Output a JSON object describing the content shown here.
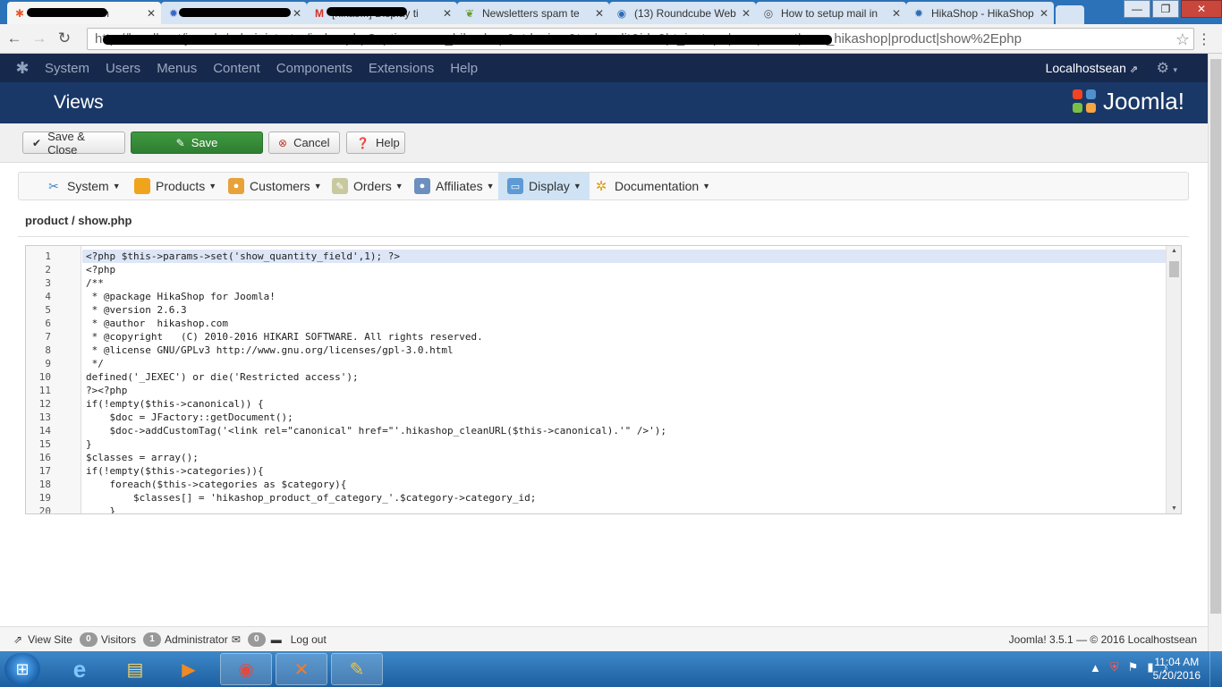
{
  "browser": {
    "tabs": [
      {
        "label": "lhostsean - Adm",
        "favicon": "joomla-icon",
        "favicon_color": "#e8562a"
      },
      {
        "label": "",
        "favicon": "hikashop-icon",
        "favicon_color": "#3b66c4"
      },
      {
        "label": "[hikas...] Display ti",
        "favicon": "gmail-icon",
        "favicon_color": "#d93025"
      },
      {
        "label": "Newsletters spam te",
        "favicon": "leaf-icon",
        "favicon_color": "#6a9a2f"
      },
      {
        "label": "(13) Roundcube Web",
        "favicon": "roundcube-icon",
        "favicon_color": "#2f6db3"
      },
      {
        "label": "How to setup mail in",
        "favicon": "globe-icon",
        "favicon_color": "#555555"
      },
      {
        "label": "HikaShop - HikaShop",
        "favicon": "hikashop-icon",
        "favicon_color": "#2e6fb0"
      }
    ],
    "url": "http://localhost/joomla/administrator/index.php?option=com_hikashop&ctrl=view&task=edit&id=0|rt_isotope|component|com_hikashop|product|show%2Ephp",
    "window_buttons": {
      "minimize": "—",
      "maximize": "❐",
      "close": "✕"
    }
  },
  "joomla_nav": {
    "items": [
      "System",
      "Users",
      "Menus",
      "Content",
      "Components",
      "Extensions",
      "Help"
    ],
    "site_name": "Localhostsean"
  },
  "header": {
    "title": "Views",
    "brand": "Joomla!"
  },
  "toolbar": {
    "save_close": "Save & Close",
    "save": "Save",
    "cancel": "Cancel",
    "help": "Help"
  },
  "hikashop_menu": {
    "items": [
      {
        "label": "System",
        "icon": "tools-icon"
      },
      {
        "label": "Products",
        "icon": "box-icon"
      },
      {
        "label": "Customers",
        "icon": "users-icon"
      },
      {
        "label": "Orders",
        "icon": "orders-icon"
      },
      {
        "label": "Affiliates",
        "icon": "affiliates-icon"
      },
      {
        "label": "Display",
        "icon": "display-icon",
        "active": true
      },
      {
        "label": "Documentation",
        "icon": "documentation-icon"
      }
    ]
  },
  "file_heading": "product / show.php",
  "editor": {
    "current_line": 1,
    "lines": [
      {
        "n": "1",
        "text": "<?php $this->params->set('show_quantity_field',1); ?>"
      },
      {
        "n": "2",
        "text": "<?php"
      },
      {
        "n": "3",
        "text": "/**"
      },
      {
        "n": "4",
        "text": " * @package HikaShop for Joomla!"
      },
      {
        "n": "5",
        "text": " * @version 2.6.3"
      },
      {
        "n": "6",
        "text": " * @author  hikashop.com"
      },
      {
        "n": "7",
        "text": " * @copyright   (C) 2010-2016 HIKARI SOFTWARE. All rights reserved."
      },
      {
        "n": "8",
        "text": " * @license GNU/GPLv3 http://www.gnu.org/licenses/gpl-3.0.html"
      },
      {
        "n": "9",
        "text": " */"
      },
      {
        "n": "10",
        "text": "defined('_JEXEC') or die('Restricted access');"
      },
      {
        "n": "11",
        "text": "?><?php"
      },
      {
        "n": "12",
        "text": "if(!empty($this->canonical)) {"
      },
      {
        "n": "13",
        "text": "    $doc = JFactory::getDocument();"
      },
      {
        "n": "14",
        "text": "    $doc->addCustomTag('<link rel=\"canonical\" href=\"'.hikashop_cleanURL($this->canonical).'\" />');"
      },
      {
        "n": "15",
        "text": "}"
      },
      {
        "n": "16",
        "text": "$classes = array();"
      },
      {
        "n": "17",
        "text": "if(!empty($this->categories)){"
      },
      {
        "n": "18",
        "text": "    foreach($this->categories as $category){"
      },
      {
        "n": "19",
        "text": "        $classes[] = 'hikashop_product_of_category_'.$category->category_id;"
      },
      {
        "n": "20",
        "text": "    }"
      }
    ]
  },
  "status": {
    "view_site": "View Site",
    "visitors_count": "0",
    "visitors_label": "Visitors",
    "admins_count": "1",
    "admins_label": "Administrator",
    "messages_count": "0",
    "logout": "Log out",
    "version": "Joomla! 3.5.1",
    "copyright": "— © 2016 Localhostsean"
  },
  "taskbar": {
    "time": "11:04 AM",
    "date": "5/20/2016"
  },
  "colors": {
    "joomla_nav_bg": "#17284d",
    "joomla_header_bg": "#1a3867",
    "save_green": "#2f7d32",
    "active_menu": "#cfe3f5",
    "taskbar_blue": "#2a6fb2"
  }
}
